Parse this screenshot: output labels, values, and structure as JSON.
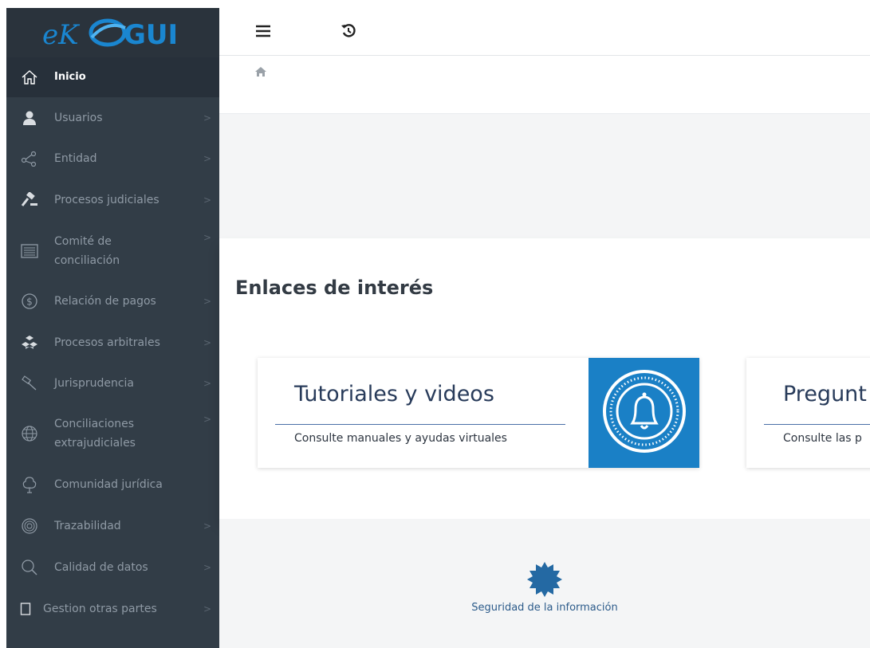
{
  "brand": {
    "logo_prefix": "eK",
    "logo_suffix": "GUI"
  },
  "sidebar": {
    "items": [
      {
        "label": "Inicio",
        "icon": "home-icon",
        "active": true,
        "chevron": false
      },
      {
        "label": "Usuarios",
        "icon": "user-icon",
        "chevron": true
      },
      {
        "label": "Entidad",
        "icon": "share-nodes-icon",
        "chevron": true
      },
      {
        "label": "Procesos judiciales",
        "icon": "gavel-icon",
        "chevron": true
      },
      {
        "label": "Comité de conciliación",
        "icon": "list-box-icon",
        "chevron": true
      },
      {
        "label": "Relación de pagos",
        "icon": "dollar-circle-icon",
        "chevron": true
      },
      {
        "label": "Procesos arbitrales",
        "icon": "cubes-icon",
        "chevron": true
      },
      {
        "label": "Jurisprudencia",
        "icon": "hammer-icon",
        "chevron": true
      },
      {
        "label": "Conciliaciones extrajudiciales",
        "icon": "globe-icon",
        "chevron": true
      },
      {
        "label": "Comunidad jurídica",
        "icon": "tree-icon",
        "chevron": false
      },
      {
        "label": "Trazabilidad",
        "icon": "fingerprint-icon",
        "chevron": true
      },
      {
        "label": "Calidad de datos",
        "icon": "search-icon",
        "chevron": true
      },
      {
        "label": "Gestion otras partes",
        "icon": "square-icon",
        "chevron": true
      }
    ],
    "chevron_glyph": ">"
  },
  "main": {
    "section_title": "Enlaces de interés",
    "cards": [
      {
        "title": "Tutoriales y videos",
        "subtitle": "Consulte manuales y ayudas virtuales",
        "icon": "bell-icon"
      },
      {
        "title": "Pregunt",
        "subtitle": "Consulte las p"
      }
    ]
  },
  "footer": {
    "link_text": "Seguridad de la información",
    "icon": "badge-icon"
  },
  "colors": {
    "sidebar_bg": "#323d47",
    "sidebar_active": "#27303a",
    "accent_blue": "#1a80c6",
    "title_navy": "#283b5a",
    "footer_link": "#2c5b8a"
  }
}
